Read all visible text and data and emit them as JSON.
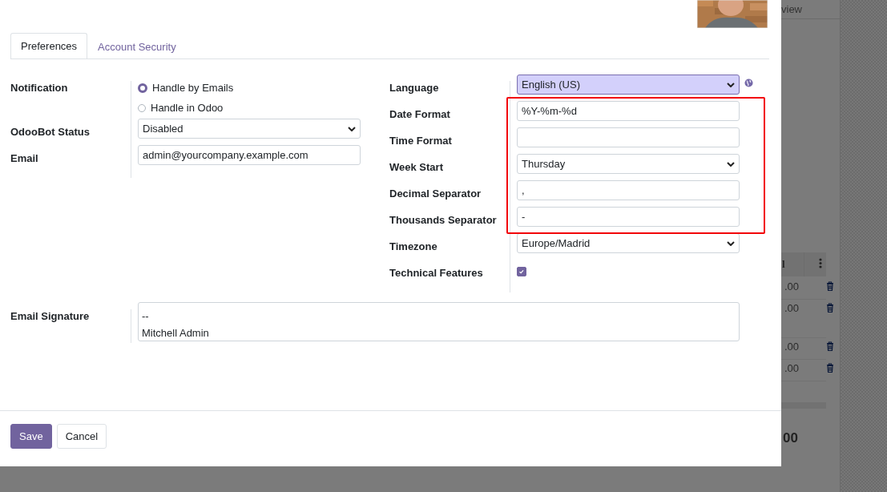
{
  "background": {
    "tab_fragment": "view",
    "column_fragment": "l",
    "amounts": [
      ".00",
      ".00",
      ".00",
      ".00"
    ],
    "total_fragment": "00"
  },
  "tabs": [
    {
      "label": "Preferences",
      "selected": true
    },
    {
      "label": "Account Security",
      "selected": false
    }
  ],
  "left_fields": [
    {
      "label": "Notification",
      "kind": "radio",
      "options": [
        {
          "label": "Handle by Emails",
          "selected": true
        },
        {
          "label": "Handle in Odoo",
          "selected": false
        }
      ]
    },
    {
      "label": "OdooBot Status",
      "kind": "select",
      "value": "Disabled"
    },
    {
      "label": "Email",
      "kind": "input",
      "value": "admin@yourcompany.example.com"
    }
  ],
  "right_fields": [
    {
      "label": "Language",
      "kind": "select",
      "value": "English (US)",
      "focused": true
    },
    {
      "label": "Date Format",
      "kind": "input",
      "value": "%Y-%m-%d"
    },
    {
      "label": "Time Format",
      "kind": "input"
    },
    {
      "label": "Week Start",
      "kind": "select",
      "value": "Thursday"
    },
    {
      "label": "Decimal Separator",
      "kind": "input",
      "value": ","
    },
    {
      "label": "Thousands Separator",
      "kind": "input",
      "value": "-"
    },
    {
      "label": "Timezone",
      "kind": "select",
      "value": "Europe/Madrid"
    },
    {
      "label": "Technical Features",
      "kind": "checkbox",
      "checked": true
    }
  ],
  "email_signature": {
    "label": "Email Signature",
    "lines": [
      "--",
      "Mitchell Admin"
    ]
  },
  "buttons": [
    {
      "label": "Save",
      "kind": "primary"
    },
    {
      "label": "Cancel",
      "kind": "secondary"
    }
  ]
}
